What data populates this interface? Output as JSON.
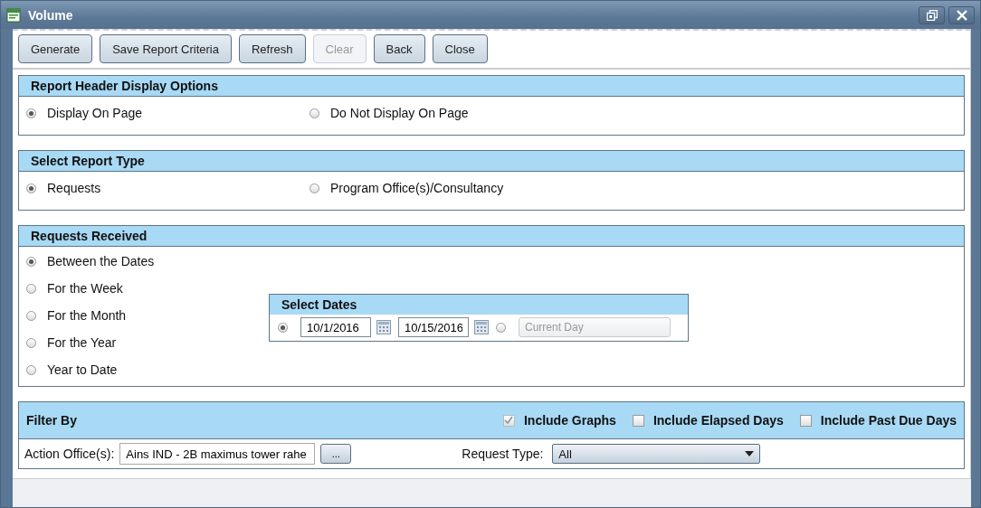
{
  "window": {
    "title": "Volume"
  },
  "toolbar": [
    {
      "label": "Generate",
      "disabled": false
    },
    {
      "label": "Save Report Criteria",
      "disabled": false
    },
    {
      "label": "Refresh",
      "disabled": false
    },
    {
      "label": "Clear",
      "disabled": true
    },
    {
      "label": "Back",
      "disabled": false
    },
    {
      "label": "Close",
      "disabled": false
    }
  ],
  "sections": [
    {
      "title": "Report Header Display Options",
      "kind": "row",
      "options": [
        {
          "label": "Display On Page",
          "selected": true
        },
        {
          "label": "Do Not Display On Page",
          "selected": false
        }
      ]
    },
    {
      "title": "Select Report Type",
      "kind": "row",
      "options": [
        {
          "label": "Requests",
          "selected": true
        },
        {
          "label": "Program Office(s)/Consultancy",
          "selected": false
        }
      ]
    },
    {
      "title": "Requests Received",
      "kind": "column",
      "options": [
        {
          "label": "Between the Dates",
          "selected": true
        },
        {
          "label": "For the Week",
          "selected": false
        },
        {
          "label": "For the Month",
          "selected": false
        },
        {
          "label": "For the Year",
          "selected": false
        },
        {
          "label": "Year to Date",
          "selected": false
        }
      ],
      "select_dates": {
        "title": "Select Dates",
        "range_selected": true,
        "from": "10/1/2016",
        "to": "10/15/2016",
        "preset_selected": false,
        "preset": "Current Day"
      }
    }
  ],
  "filter": {
    "title": "Filter By",
    "checks": [
      {
        "label": "Include Graphs",
        "checked": true,
        "disabled": true
      },
      {
        "label": "Include Elapsed Days",
        "checked": false,
        "disabled": false
      },
      {
        "label": "Include Past Due Days",
        "checked": false,
        "disabled": false
      }
    ],
    "action_office_label": "Action Office(s):",
    "action_office": "Ains IND - 2B maximus tower rahe",
    "browse": "...",
    "request_type_label": "Request Type:",
    "request_type": "All"
  }
}
